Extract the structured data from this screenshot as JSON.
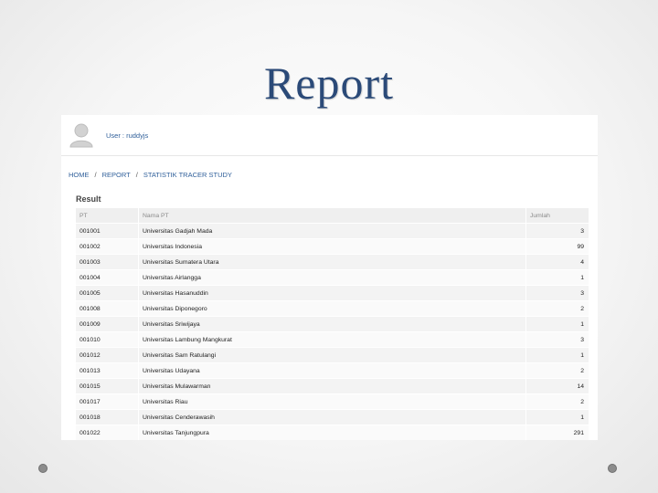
{
  "slide": {
    "title": "Report"
  },
  "user": {
    "label": "User : ruddyjs"
  },
  "breadcrumb": [
    {
      "label": "HOME"
    },
    {
      "label": "REPORT"
    },
    {
      "label": "STATISTIK TRACER STUDY"
    }
  ],
  "breadcrumb_separator": "/",
  "result": {
    "title": "Result",
    "columns": [
      "PT",
      "Nama PT",
      "Jumlah"
    ],
    "rows": [
      {
        "pt": "001001",
        "nama": "Universitas Gadjah Mada",
        "jumlah": "3"
      },
      {
        "pt": "001002",
        "nama": "Universitas Indonesia",
        "jumlah": "99"
      },
      {
        "pt": "001003",
        "nama": "Universitas Sumatera Utara",
        "jumlah": "4"
      },
      {
        "pt": "001004",
        "nama": "Universitas Airlangga",
        "jumlah": "1"
      },
      {
        "pt": "001005",
        "nama": "Universitas Hasanuddin",
        "jumlah": "3"
      },
      {
        "pt": "001008",
        "nama": "Universitas Diponegoro",
        "jumlah": "2"
      },
      {
        "pt": "001009",
        "nama": "Universitas Sriwijaya",
        "jumlah": "1"
      },
      {
        "pt": "001010",
        "nama": "Universitas Lambung Mangkurat",
        "jumlah": "3"
      },
      {
        "pt": "001012",
        "nama": "Universitas Sam Ratulangi",
        "jumlah": "1"
      },
      {
        "pt": "001013",
        "nama": "Universitas Udayana",
        "jumlah": "2"
      },
      {
        "pt": "001015",
        "nama": "Universitas Mulawarman",
        "jumlah": "14"
      },
      {
        "pt": "001017",
        "nama": "Universitas Riau",
        "jumlah": "2"
      },
      {
        "pt": "001018",
        "nama": "Universitas Cenderawasih",
        "jumlah": "1"
      },
      {
        "pt": "001022",
        "nama": "Universitas Tanjungpura",
        "jumlah": "291"
      }
    ]
  },
  "colors": {
    "title": "#2b4a78",
    "link": "#2f5f9a"
  },
  "icons": {
    "avatar": "user-avatar-icon",
    "bullet": "bullet-dot"
  }
}
